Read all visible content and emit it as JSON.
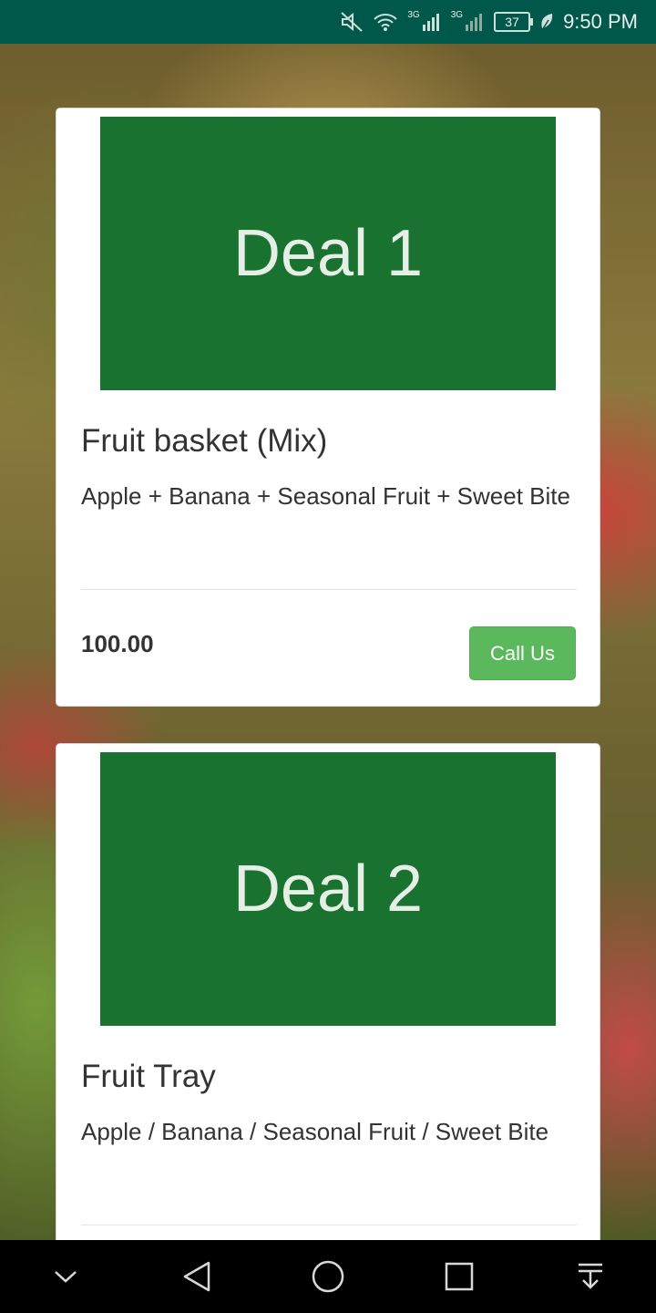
{
  "status_bar": {
    "time": "9:50 PM",
    "battery": "37",
    "network_1": "3G",
    "network_2": "3G",
    "icons": [
      "mute-icon",
      "wifi-icon",
      "signal-icon",
      "signal-icon",
      "battery-icon",
      "leaf-icon"
    ]
  },
  "deals": [
    {
      "image_text": "Deal 1",
      "title": "Fruit basket (Mix)",
      "description": "Apple + Banana + Seasonal Fruit + Sweet Bite",
      "price": "100.00",
      "button_label": "Call Us"
    },
    {
      "image_text": "Deal 2",
      "title": "Fruit Tray",
      "description": "Apple / Banana / Seasonal Fruit / Sweet Bite"
    }
  ],
  "nav_bar": {
    "icons": [
      "chevron-down-icon",
      "back-icon",
      "home-icon",
      "recents-icon",
      "notification-pull-icon"
    ]
  },
  "colors": {
    "status_bar": "#00584a",
    "deal_image": "#1a7230",
    "button": "#5cb85c",
    "nav_bar": "#000000"
  }
}
